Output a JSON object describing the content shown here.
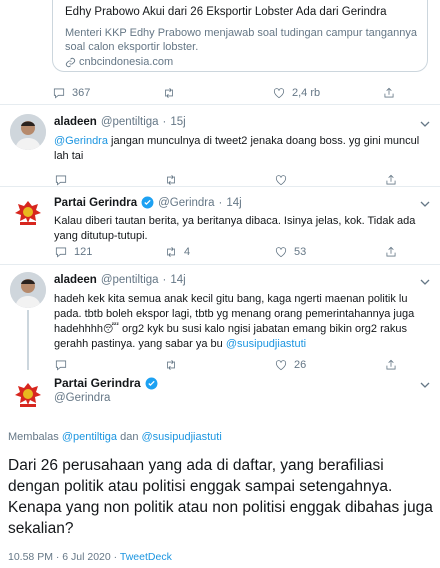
{
  "card": {
    "title": "Edhy Prabowo Akui dari 26 Eksportir Lobster Ada dari Gerindra",
    "desc": "Menteri KKP Edhy Prabowo menjawab soal tudingan campur tangannya soal calon eksportir lobster.",
    "domain": "cnbcindonesia.com"
  },
  "top_actions": {
    "replies": "367",
    "retweets": "",
    "likes": "2,4 rb"
  },
  "tweets": [
    {
      "name": "aladeen",
      "handle": "@pentiltiga",
      "time": "15j",
      "mention": "@Gerindra",
      "text": " jangan munculnya di tweet2 jenaka doang boss. yg gini muncul lah tai",
      "replies": "",
      "retweets": "",
      "likes": ""
    },
    {
      "name": "Partai Gerindra",
      "handle": "@Gerindra",
      "time": "14j",
      "text": "Kalau diberi tautan berita, ya beritanya dibaca. Isinya jelas, kok. Tidak ada yang ditutup-tutupi.",
      "replies": "121",
      "retweets": "4",
      "likes": "53"
    },
    {
      "name": "aladeen",
      "handle": "@pentiltiga",
      "time": "14j",
      "text_1": "hadeh kek kita semua anak kecil gitu bang, kaga ngerti maenan politik lu pada. tbtb boleh ekspor lagi, tbtb yg menang orang pemerintahannya juga hadehhhh",
      "emoji": "😴",
      "text_2": " org2 kyk bu susi kalo ngisi jabatan emang bikin org2 rakus gerahh pastinya. yang sabar ya bu ",
      "mention": "@susipudjiastuti",
      "replies": "",
      "retweets": "",
      "likes": "26"
    }
  ],
  "main": {
    "name": "Partai Gerindra",
    "handle": "@Gerindra",
    "replying_label": "Membalas",
    "replying_to_1": "@pentiltiga",
    "replying_and": "dan",
    "replying_to_2": "@susipudjiastuti",
    "text": "Dari 26 perusahaan yang ada di daftar, yang berafiliasi dengan politik atau politisi enggak sampai setengahnya. Kenapa yang non politik atau non politisi enggak dibahas juga sekalian?",
    "time": "10.58 PM · 6 Jul 2020 ·",
    "source": "TweetDeck"
  },
  "colors": {
    "link": "#1b95e0",
    "muted": "#657786",
    "verified": "#1da1f2",
    "party_red": "#d7261e",
    "party_gold": "#e8b81f"
  },
  "icons": [
    "reply-icon",
    "retweet-icon",
    "like-icon",
    "share-icon",
    "verified-icon",
    "link-icon",
    "chevron-down-icon"
  ]
}
